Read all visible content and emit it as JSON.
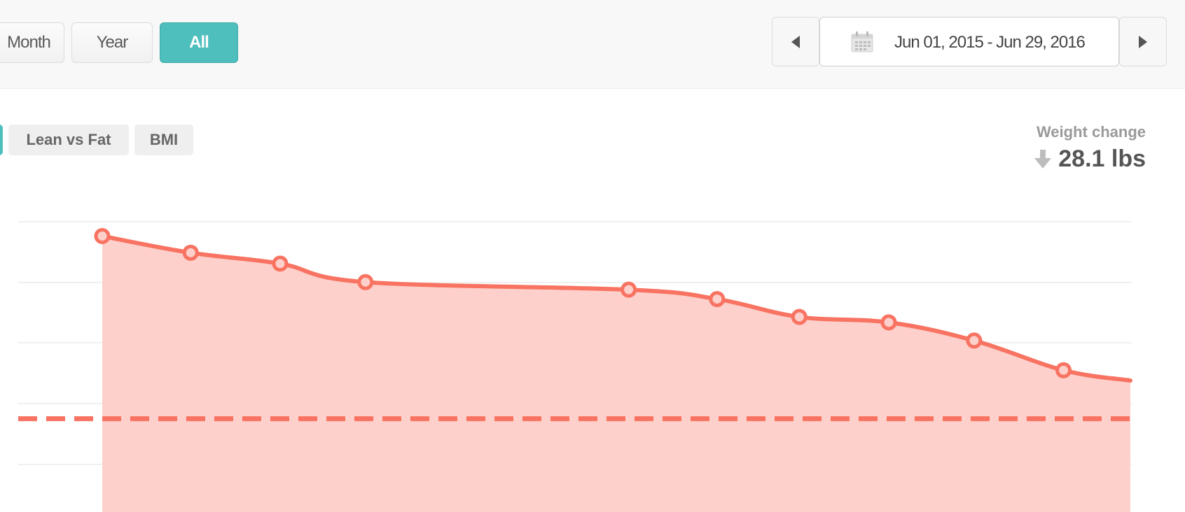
{
  "range_buttons": {
    "month": "Month",
    "year": "Year",
    "all": "All"
  },
  "date_range": {
    "label": "Jun 01, 2015 - Jun 29, 2016"
  },
  "tabs": {
    "lean_vs_fat": "Lean vs Fat",
    "bmi": "BMI"
  },
  "weight_change": {
    "label": "Weight change",
    "value": "28.1 lbs",
    "direction": "down"
  },
  "colors": {
    "accent": "#4ebfbd",
    "line": "#f87361",
    "fill": "#fdd0cb",
    "grid": "#ececec"
  },
  "chart_data": {
    "type": "area",
    "values": [
      91.1,
      85.6,
      82.0,
      75.9,
      73.4,
      70.3,
      64.4,
      62.6,
      56.6,
      46.8,
      43.4
    ],
    "markers": [
      true,
      true,
      true,
      true,
      true,
      true,
      true,
      true,
      true,
      true,
      false
    ],
    "x_fraction": [
      0.0,
      0.086,
      0.173,
      0.256,
      0.512,
      0.598,
      0.678,
      0.765,
      0.848,
      0.935,
      1.0
    ],
    "goal_value": 30.8,
    "ylim": [
      0,
      115
    ],
    "grid": true
  }
}
